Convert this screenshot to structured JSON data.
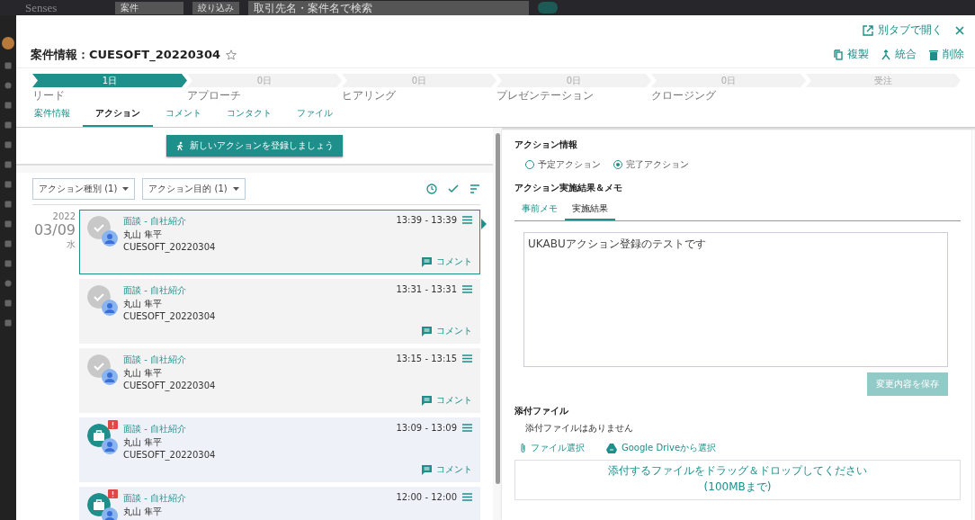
{
  "top_bar": {
    "logo": "Senses",
    "object_select": "案件",
    "filter_button": "絞り込み",
    "search": {
      "placeholder": "取引先名・案件名で検索"
    }
  },
  "modal": {
    "title": "案件情報：CUESOFT_20220304",
    "starred": false,
    "header_actions": [
      {
        "kind": "open-tab",
        "label": "別タブで開く"
      }
    ],
    "toolbar": [
      {
        "kind": "copy",
        "label": "複製"
      },
      {
        "kind": "merge",
        "label": "統合"
      },
      {
        "kind": "delete",
        "label": "削除"
      }
    ],
    "stages": [
      {
        "count": "1日",
        "label": "リード",
        "active": true
      },
      {
        "count": "0日",
        "label": "アプローチ",
        "active": false
      },
      {
        "count": "0日",
        "label": "ヒアリング",
        "active": false
      },
      {
        "count": "0日",
        "label": "プレゼンテーション",
        "active": false
      },
      {
        "count": "0日",
        "label": "クロージング",
        "active": false
      },
      {
        "count": "受注",
        "active": false
      }
    ],
    "tabs": [
      {
        "label": "案件情報",
        "selected": false
      },
      {
        "label": "アクション",
        "selected": true
      },
      {
        "label": "コメント",
        "selected": false
      },
      {
        "label": "コンタクト",
        "selected": false
      },
      {
        "label": "ファイル",
        "selected": false
      }
    ]
  },
  "actions_panel": {
    "new_action_button": "新しいアクションを登録しましょう",
    "filters": [
      "アクション種別 (1)",
      "アクション目的 (1)"
    ],
    "date": {
      "year": "2022",
      "day": "03/09",
      "weekday": "水"
    },
    "items": [
      {
        "kind": "done",
        "title": "面談 - 自社紹介",
        "time": "13:39 - 13:39",
        "person": "丸山 隼平",
        "deal": "CUESOFT_20220304",
        "comment": "コメント",
        "selected": true
      },
      {
        "kind": "done",
        "title": "面談 - 自社紹介",
        "time": "13:31 - 13:31",
        "person": "丸山 隼平",
        "deal": "CUESOFT_20220304",
        "comment": "コメント",
        "selected": false
      },
      {
        "kind": "done",
        "title": "面談 - 自社紹介",
        "time": "13:15 - 13:15",
        "person": "丸山 隼平",
        "deal": "CUESOFT_20220304",
        "comment": "コメント",
        "selected": false
      },
      {
        "kind": "task",
        "title": "面談 - 自社紹介",
        "time": "13:09 - 13:09",
        "person": "丸山 隼平",
        "deal": "CUESOFT_20220304",
        "comment": "コメント",
        "selected": false
      },
      {
        "kind": "task",
        "title": "面談 - 自社紹介",
        "time": "12:00 - 12:00",
        "person": "丸山 隼平",
        "selected": false
      }
    ]
  },
  "detail_panel": {
    "heading": "アクション情報",
    "radios": [
      {
        "label": "予定アクション",
        "selected": false
      },
      {
        "label": "完了アクション",
        "selected": true
      }
    ],
    "memo_heading": "アクション実施結果＆メモ",
    "memo_tabs": [
      {
        "label": "事前メモ",
        "selected": false
      },
      {
        "label": "実施結果",
        "selected": true
      }
    ],
    "memo_value": "UKABUアクション登録のテストです",
    "save_button": {
      "label": "変更内容を保存",
      "disabled": true
    },
    "attachments_heading": "添付ファイル",
    "attachments_empty": "添付ファイルはありません",
    "file_select": "ファイル選択",
    "drive_select": "Google Driveから選択",
    "dropzone": [
      "添付するファイルをドラッグ＆ドロップしてください",
      "(100MBまで)"
    ]
  }
}
